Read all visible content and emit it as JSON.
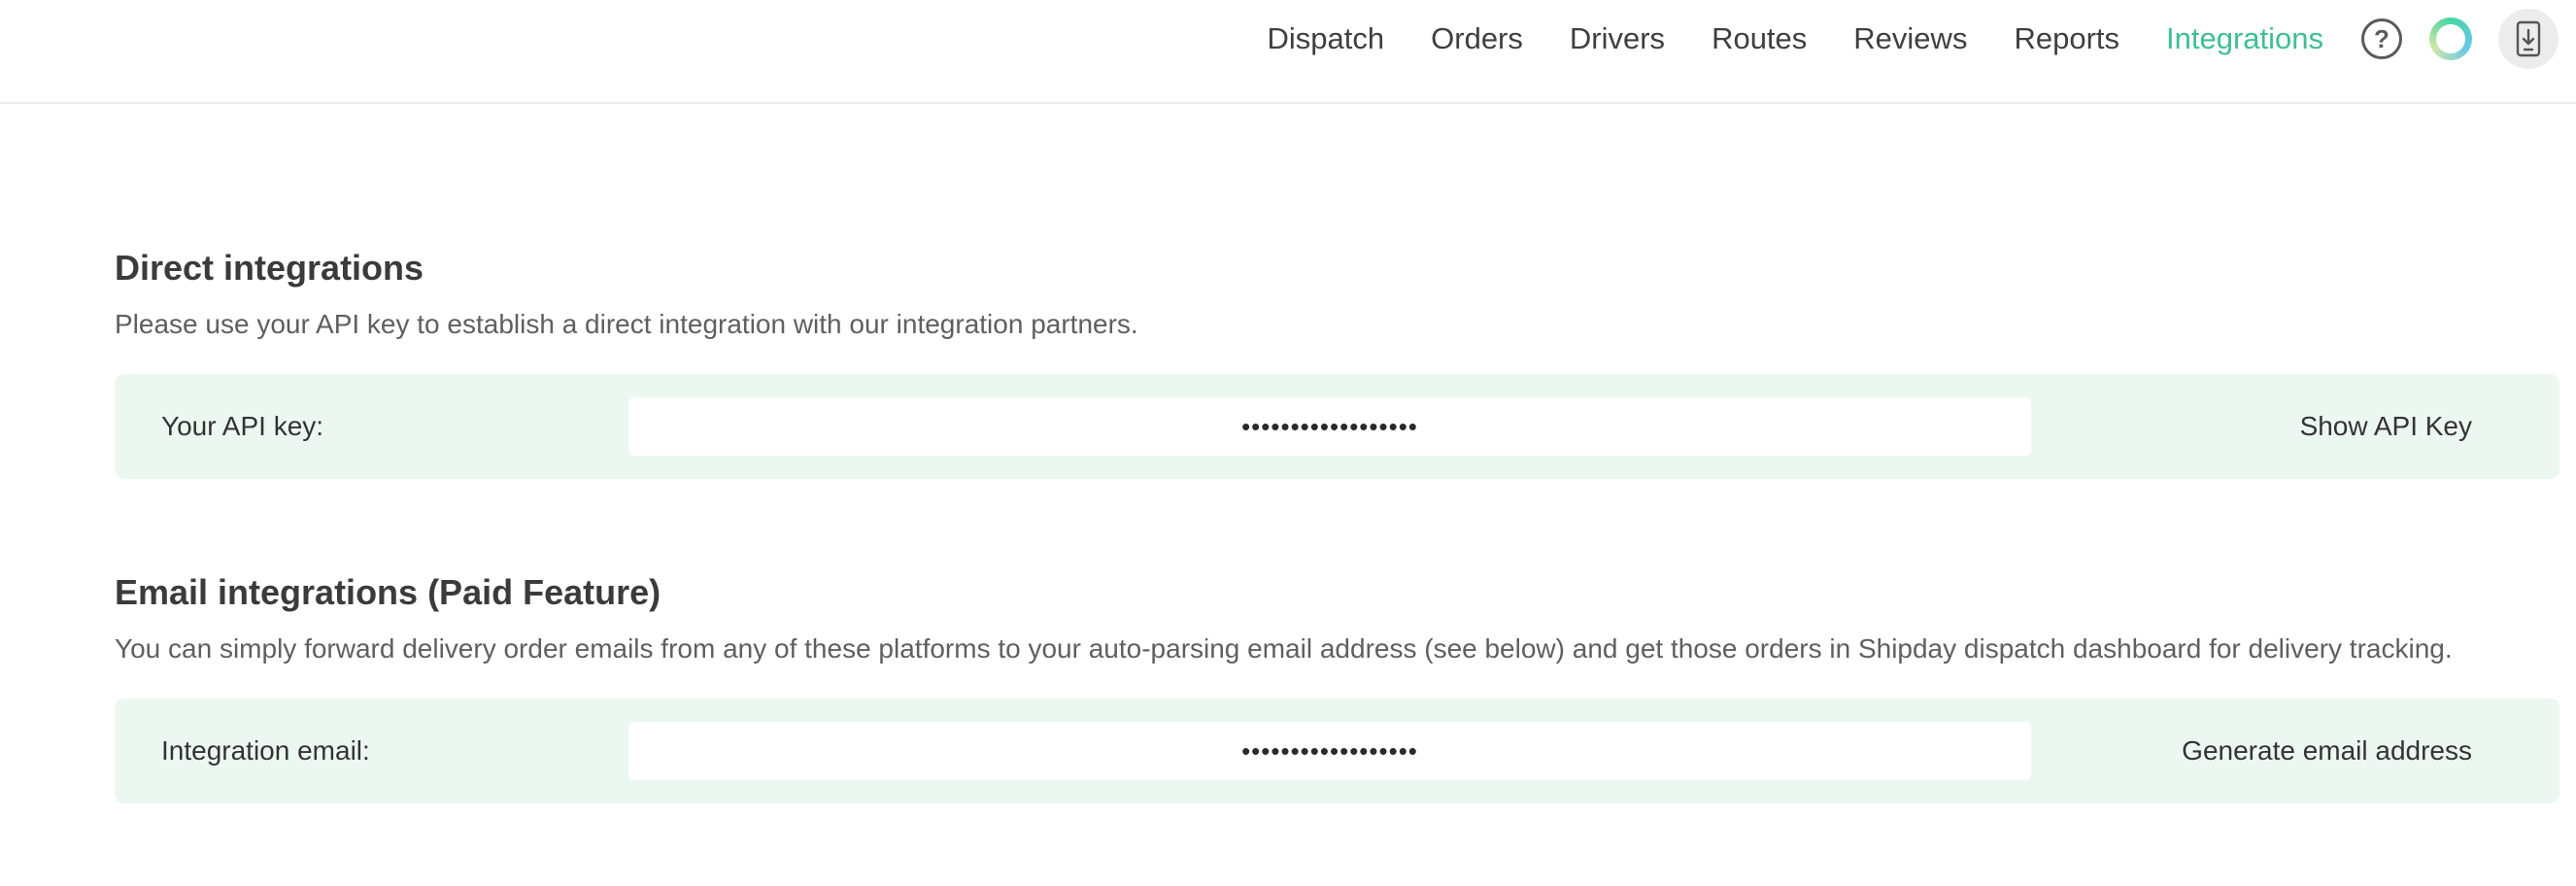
{
  "nav": {
    "items": [
      {
        "label": "Dispatch",
        "active": false
      },
      {
        "label": "Orders",
        "active": false
      },
      {
        "label": "Drivers",
        "active": false
      },
      {
        "label": "Routes",
        "active": false
      },
      {
        "label": "Reviews",
        "active": false
      },
      {
        "label": "Reports",
        "active": false
      },
      {
        "label": "Integrations",
        "active": true
      }
    ],
    "icons": [
      "help-icon",
      "status-ring-icon",
      "mobile-download-icon"
    ],
    "help_glyph": "?"
  },
  "colors": {
    "accent": "#3fbf8f",
    "panel_bg": "#edf7f2"
  },
  "direct": {
    "title": "Direct integrations",
    "description": "Please use your API key to establish a direct integration with our integration partners.",
    "label": "Your API key:",
    "value": "••••••••••••••••••",
    "action": "Show API Key"
  },
  "email": {
    "title": "Email integrations (Paid Feature)",
    "description": "You can simply forward delivery order emails from any of these platforms to your auto-parsing email address (see below) and get those orders in Shipday dispatch dashboard for delivery tracking.",
    "label": "Integration email:",
    "value": "••••••••••••••••••",
    "action": "Generate email address"
  }
}
